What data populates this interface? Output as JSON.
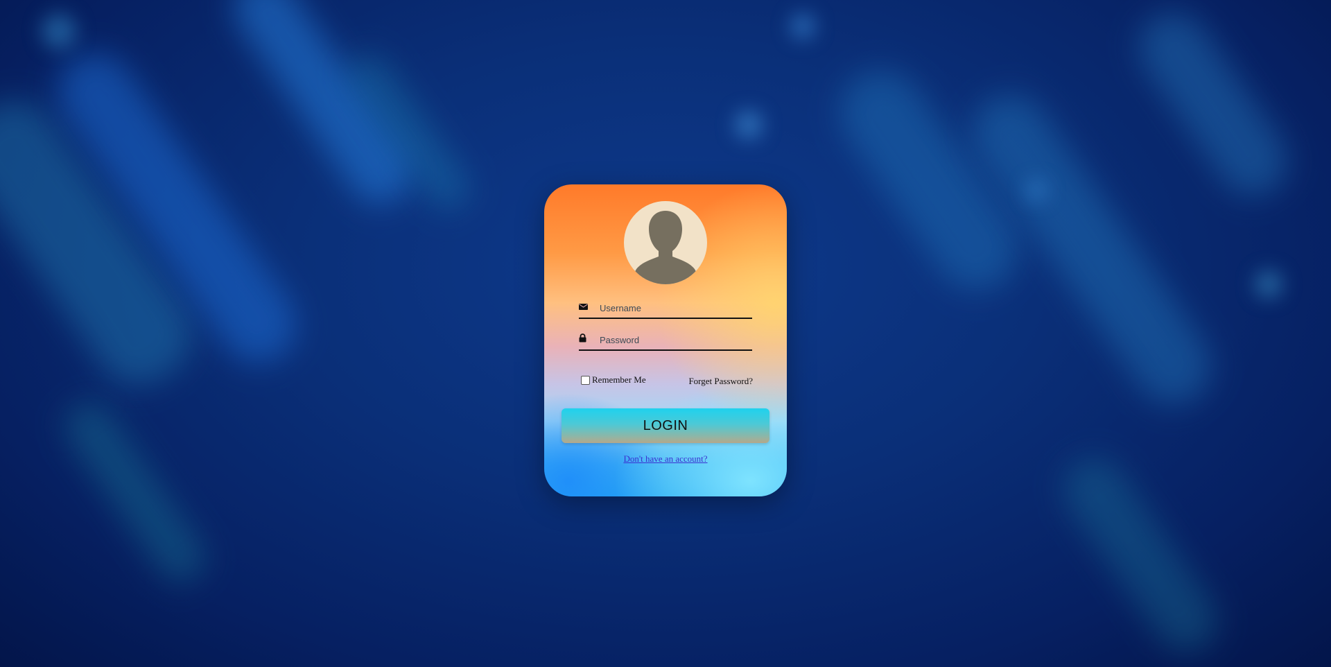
{
  "page": {
    "background_color": "#0a2f78"
  },
  "login_form": {
    "avatar_icon": "user-silhouette-icon",
    "username": {
      "icon": "envelope-icon",
      "placeholder": "Username",
      "value": ""
    },
    "password": {
      "icon": "lock-icon",
      "placeholder": "Password",
      "value": ""
    },
    "remember_me": {
      "label": "Remember Me",
      "checked": false
    },
    "forgot_password_label": "Forget Password?",
    "login_button_label": "LOGIN",
    "signup_link_label": "Don't have an account?"
  }
}
